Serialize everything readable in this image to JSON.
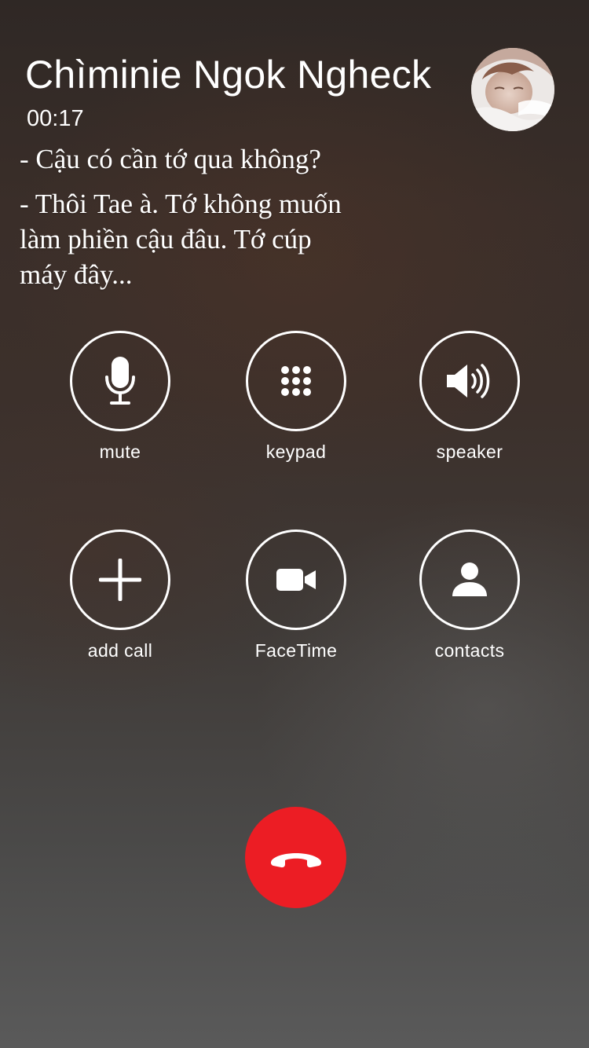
{
  "call": {
    "caller_name": "Chìminie Ngok Ngheck",
    "duration": "00:17"
  },
  "dialogue": {
    "line_1": "- Cậu có cần tớ qua không?",
    "line_2": "- Thôi Tae à. Tớ không muốn làm phiền cậu đâu. Tớ cúp máy đây..."
  },
  "controls": {
    "mute": {
      "label": "mute",
      "icon": "microphone-icon"
    },
    "keypad": {
      "label": "keypad",
      "icon": "keypad-icon"
    },
    "speaker": {
      "label": "speaker",
      "icon": "speaker-icon"
    },
    "add_call": {
      "label": "add call",
      "icon": "plus-icon"
    },
    "facetime": {
      "label": "FaceTime",
      "icon": "video-camera-icon"
    },
    "contacts": {
      "label": "contacts",
      "icon": "person-icon"
    }
  },
  "end_call": {
    "icon": "phone-hangup-icon",
    "color": "#ec1d24"
  },
  "colors": {
    "foreground": "#ffffff",
    "end_call_red": "#ec1d24"
  }
}
